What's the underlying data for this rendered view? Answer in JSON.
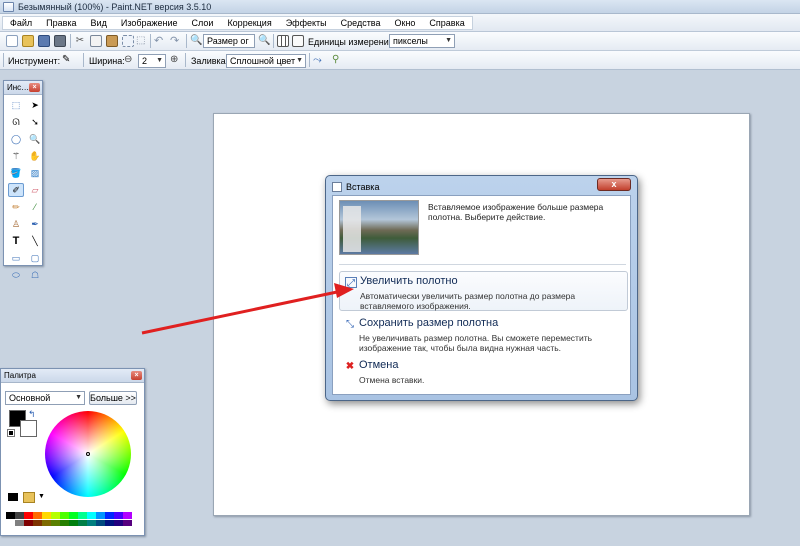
{
  "window": {
    "title": "Безымянный (100%) - Paint.NET версия 3.5.10"
  },
  "menu": [
    "Файл",
    "Правка",
    "Вид",
    "Изображение",
    "Слои",
    "Коррекция",
    "Эффекты",
    "Средства",
    "Окно",
    "Справка"
  ],
  "toolbar1": {
    "zoom_value": "Размер ог",
    "units_label": "Единицы измерения:",
    "units_value": "пикселы"
  },
  "toolbar2": {
    "tool_label": "Инструмент:",
    "width_label": "Ширина:",
    "width_value": "2",
    "fill_label": "Заливка:",
    "fill_value": "Сплошной цвет"
  },
  "tools_panel": {
    "title": "Инс…"
  },
  "palette": {
    "title": "Палитра",
    "mode_value": "Основной",
    "more_button": "Больше >>"
  },
  "dialog": {
    "title": "Вставка",
    "message": "Вставляемое изображение больше размера полотна. Выберите действие.",
    "options": [
      {
        "title": "Увеличить полотно",
        "description": "Автоматически увеличить размер полотна до размера вставляемого изображения."
      },
      {
        "title": "Сохранить размер полотна",
        "description": "Не увеличивать размер полотна. Вы сможете переместить изображение так, чтобы была видна нужная часть."
      },
      {
        "title": "Отмена",
        "description": "Отмена вставки."
      }
    ]
  },
  "colors": {
    "accent": "#e02020",
    "workspace": "#c8d3e0"
  }
}
